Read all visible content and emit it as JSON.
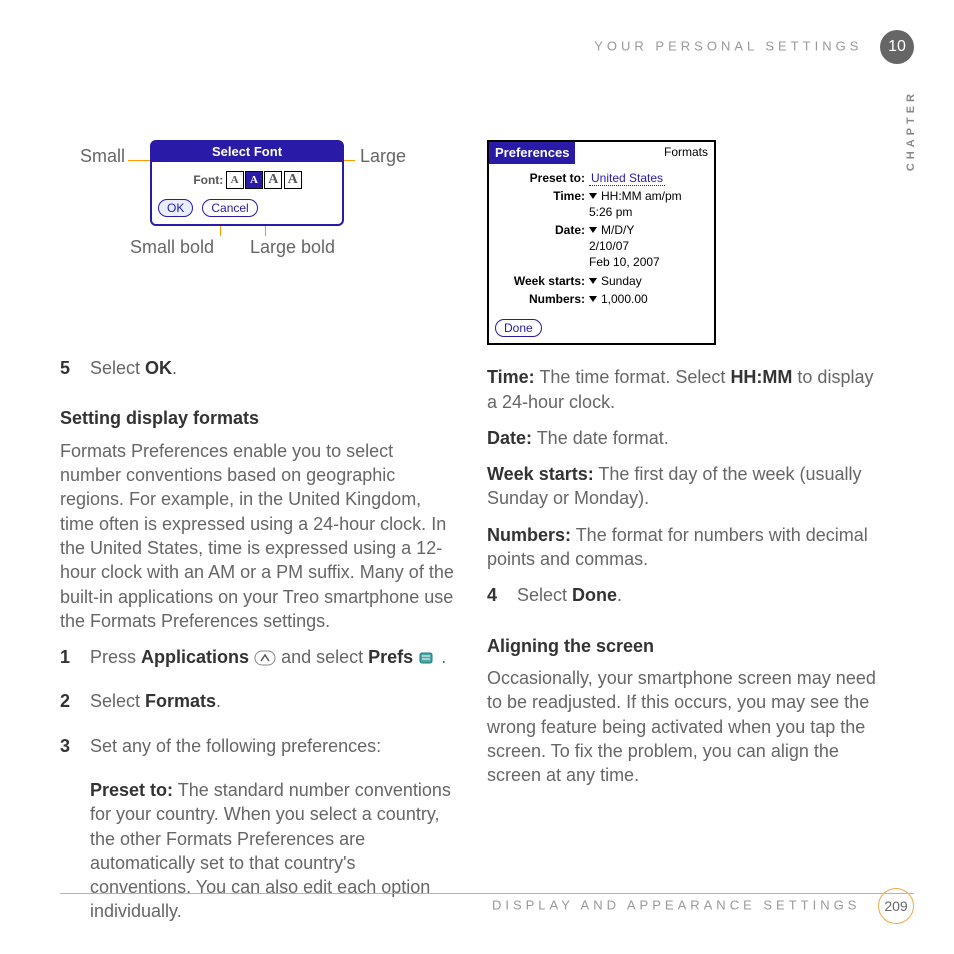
{
  "header": {
    "title": "YOUR PERSONAL SETTINGS",
    "chapter_num": "10",
    "side": "CHAPTER"
  },
  "footer": {
    "title": "DISPLAY AND APPEARANCE SETTINGS",
    "page": "209"
  },
  "font_diagram": {
    "small": "Small",
    "large": "Large",
    "small_bold": "Small bold",
    "large_bold": "Large bold",
    "title": "Select Font",
    "font_label": "Font:",
    "ok": "OK",
    "cancel": "Cancel",
    "s1": "A",
    "s2": "A",
    "s3": "A",
    "s4": "A"
  },
  "pref_dialog": {
    "tab": "Preferences",
    "right": "Formats",
    "preset_l": "Preset to:",
    "preset_v": "United States",
    "time_l": "Time:",
    "time_v": "HH:MM am/pm",
    "time_ex": "5:26 pm",
    "date_l": "Date:",
    "date_v": "M/D/Y",
    "date_ex1": "2/10/07",
    "date_ex2": "Feb 10, 2007",
    "week_l": "Week starts:",
    "week_v": "Sunday",
    "num_l": "Numbers:",
    "num_v": "1,000.00",
    "done": "Done"
  },
  "left": {
    "step5_n": "5",
    "step5_a": "Select ",
    "step5_b": "OK",
    "step5_c": ".",
    "h1": "Setting display formats",
    "p1": "Formats Preferences enable you to select number conventions based on geographic regions. For example, in the United Kingdom, time often is expressed using a 24-hour clock. In the United States, time is expressed using a 12-hour clock with an AM or a PM suffix. Many of the built-in applications on your Treo smartphone use the Formats Preferences settings.",
    "s1_n": "1",
    "s1_a": "Press ",
    "s1_b": "Applications",
    "s1_c": " and select ",
    "s1_d": "Prefs",
    "s1_e": " .",
    "s2_n": "2",
    "s2_a": "Select ",
    "s2_b": "Formats",
    "s2_c": ".",
    "s3_n": "3",
    "s3": "Set any of the following preferences:",
    "preset_b": "Preset to:",
    "preset_t": " The standard number conventions for your country. When you select a country, the other Formats Preferences are automatically set to that country's conventions. You can also edit each option individually."
  },
  "right": {
    "time_b": "Time:",
    "time_t": " The time format. Select ",
    "time_b2": "HH:MM",
    "time_t2": " to display a 24-hour clock.",
    "date_b": "Date:",
    "date_t": " The date format.",
    "week_b": "Week starts:",
    "week_t": " The first day of the week (usually Sunday or Monday).",
    "num_b": "Numbers:",
    "num_t": " The format for numbers with decimal points and commas.",
    "s4_n": "4",
    "s4_a": "Select ",
    "s4_b": "Done",
    "s4_c": ".",
    "h2": "Aligning the screen",
    "p2": "Occasionally, your smartphone screen may need to be readjusted. If this occurs, you may see the wrong feature being activated when you tap the screen. To fix the problem, you can align the screen at any time."
  }
}
